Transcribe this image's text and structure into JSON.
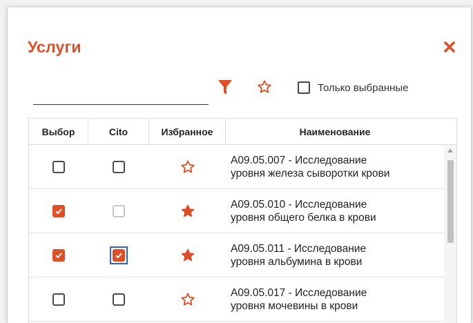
{
  "dialog": {
    "title": "Услуги",
    "search": {
      "value": "",
      "placeholder": ""
    },
    "only_selected_label": "Только выбранные"
  },
  "table": {
    "headers": {
      "select": "Выбор",
      "cito": "Cito",
      "favorite": "Избранное",
      "name": "Наименование"
    },
    "rows": [
      {
        "selected": false,
        "cito": false,
        "cito_enabled": true,
        "favorite": false,
        "name_line1": "A09.05.007 - Исследование",
        "name_line2": "уровня железа сыворотки крови"
      },
      {
        "selected": true,
        "cito": false,
        "cito_enabled": false,
        "favorite": true,
        "name_line1": "A09.05.010 - Исследование",
        "name_line2": "уровня общего белка в крови"
      },
      {
        "selected": true,
        "cito": true,
        "cito_enabled": true,
        "focused": true,
        "favorite": true,
        "name_line1": "A09.05.011 - Исследование",
        "name_line2": "уровня альбумина в крови"
      },
      {
        "selected": false,
        "cito": false,
        "cito_enabled": true,
        "favorite": false,
        "name_line1": "A09.05.017 - Исследование",
        "name_line2": "уровня мочевины в крови"
      }
    ]
  },
  "colors": {
    "accent": "#e04e26",
    "focus": "#2f5fe0",
    "text": "#222222"
  },
  "icons": [
    "close-icon",
    "filter-icon",
    "star-outline-icon",
    "star-filled-icon",
    "checkbox-icon"
  ]
}
